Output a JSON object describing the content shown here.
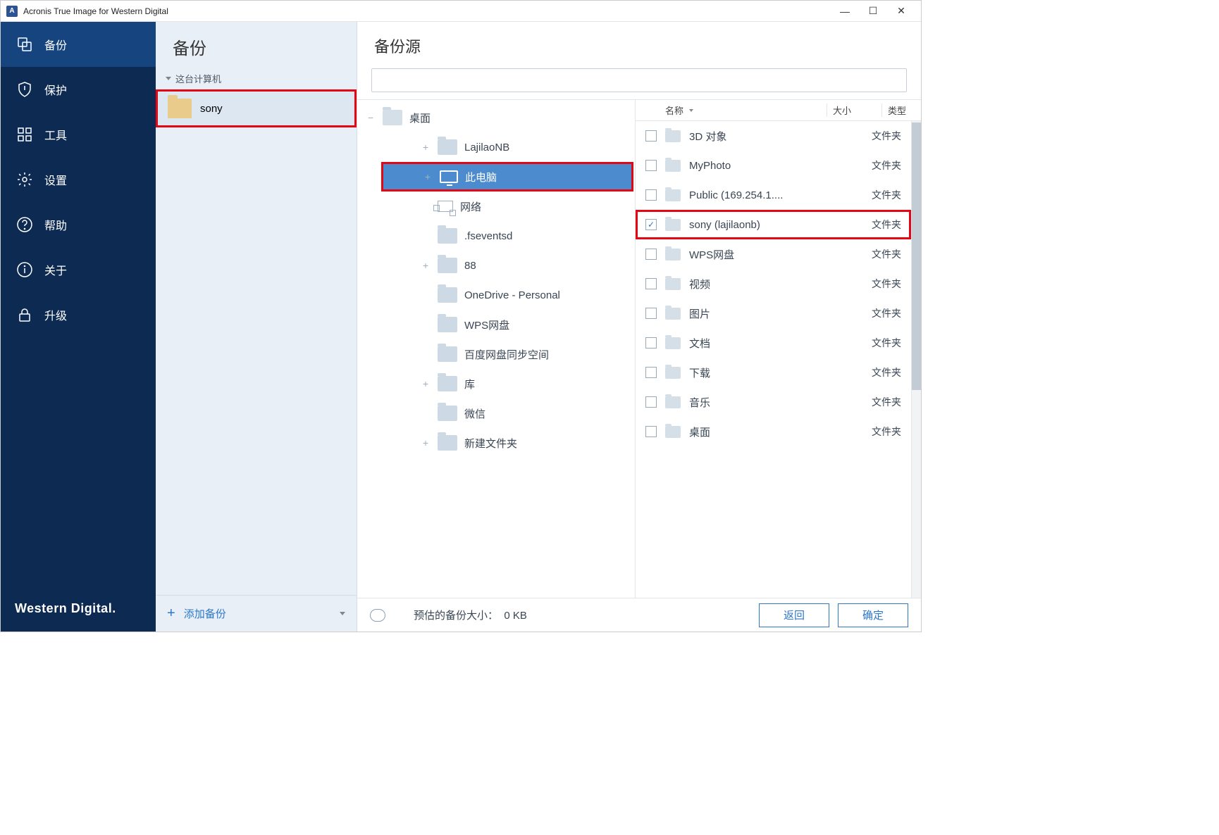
{
  "window": {
    "title": "Acronis True Image for Western Digital"
  },
  "sidebar": {
    "items": [
      {
        "label": "备份",
        "icon": "backup-icon",
        "active": true
      },
      {
        "label": "保护",
        "icon": "shield-icon",
        "active": false
      },
      {
        "label": "工具",
        "icon": "tools-icon",
        "active": false
      },
      {
        "label": "设置",
        "icon": "gear-icon",
        "active": false
      },
      {
        "label": "帮助",
        "icon": "help-icon",
        "active": false
      },
      {
        "label": "关于",
        "icon": "info-icon",
        "active": false
      },
      {
        "label": "升级",
        "icon": "lock-icon",
        "active": false
      }
    ],
    "brand": "Western Digital."
  },
  "midcol": {
    "title": "备份",
    "group_header": "这台计算机",
    "items": [
      {
        "label": "sony",
        "highlighted": true
      }
    ],
    "add_label": "添加备份"
  },
  "main": {
    "title": "备份源",
    "search_placeholder": "",
    "tree": [
      {
        "label": "桌面",
        "level": 0,
        "icon": "folder",
        "expanded": true
      },
      {
        "label": "LajilaoNB",
        "level": 1,
        "icon": "folder",
        "expandable": true
      },
      {
        "label": "此电脑",
        "level": 1,
        "icon": "monitor",
        "selected": true,
        "expandable": true
      },
      {
        "label": "网络",
        "level": 1,
        "icon": "network"
      },
      {
        "label": ".fseventsd",
        "level": 1,
        "icon": "folder"
      },
      {
        "label": "88",
        "level": 1,
        "icon": "folder",
        "expandable": true
      },
      {
        "label": "OneDrive - Personal",
        "level": 1,
        "icon": "folder"
      },
      {
        "label": "WPS网盘",
        "level": 1,
        "icon": "folder"
      },
      {
        "label": "百度网盘同步空间",
        "level": 1,
        "icon": "folder"
      },
      {
        "label": "库",
        "level": 1,
        "icon": "folder",
        "expandable": true
      },
      {
        "label": "微信",
        "level": 1,
        "icon": "folder"
      },
      {
        "label": "新建文件夹",
        "level": 1,
        "icon": "folder",
        "expandable": true
      }
    ],
    "file_headers": {
      "name": "名称",
      "size": "大小",
      "type": "类型"
    },
    "files": [
      {
        "name": "3D 对象",
        "type": "文件夹",
        "checked": false
      },
      {
        "name": "MyPhoto",
        "type": "文件夹",
        "checked": false
      },
      {
        "name": "Public (169.254.1....",
        "type": "文件夹",
        "checked": false
      },
      {
        "name": "sony (lajilaonb)",
        "type": "文件夹",
        "checked": true,
        "highlighted": true
      },
      {
        "name": "WPS网盘",
        "type": "文件夹",
        "checked": false
      },
      {
        "name": "视频",
        "type": "文件夹",
        "checked": false
      },
      {
        "name": "图片",
        "type": "文件夹",
        "checked": false
      },
      {
        "name": "文档",
        "type": "文件夹",
        "checked": false
      },
      {
        "name": "下载",
        "type": "文件夹",
        "checked": false
      },
      {
        "name": "音乐",
        "type": "文件夹",
        "checked": false
      },
      {
        "name": "桌面",
        "type": "文件夹",
        "checked": false
      }
    ],
    "status": {
      "label": "预估的备份大小：",
      "value": "0 KB"
    },
    "buttons": {
      "back": "返回",
      "ok": "确定"
    }
  }
}
